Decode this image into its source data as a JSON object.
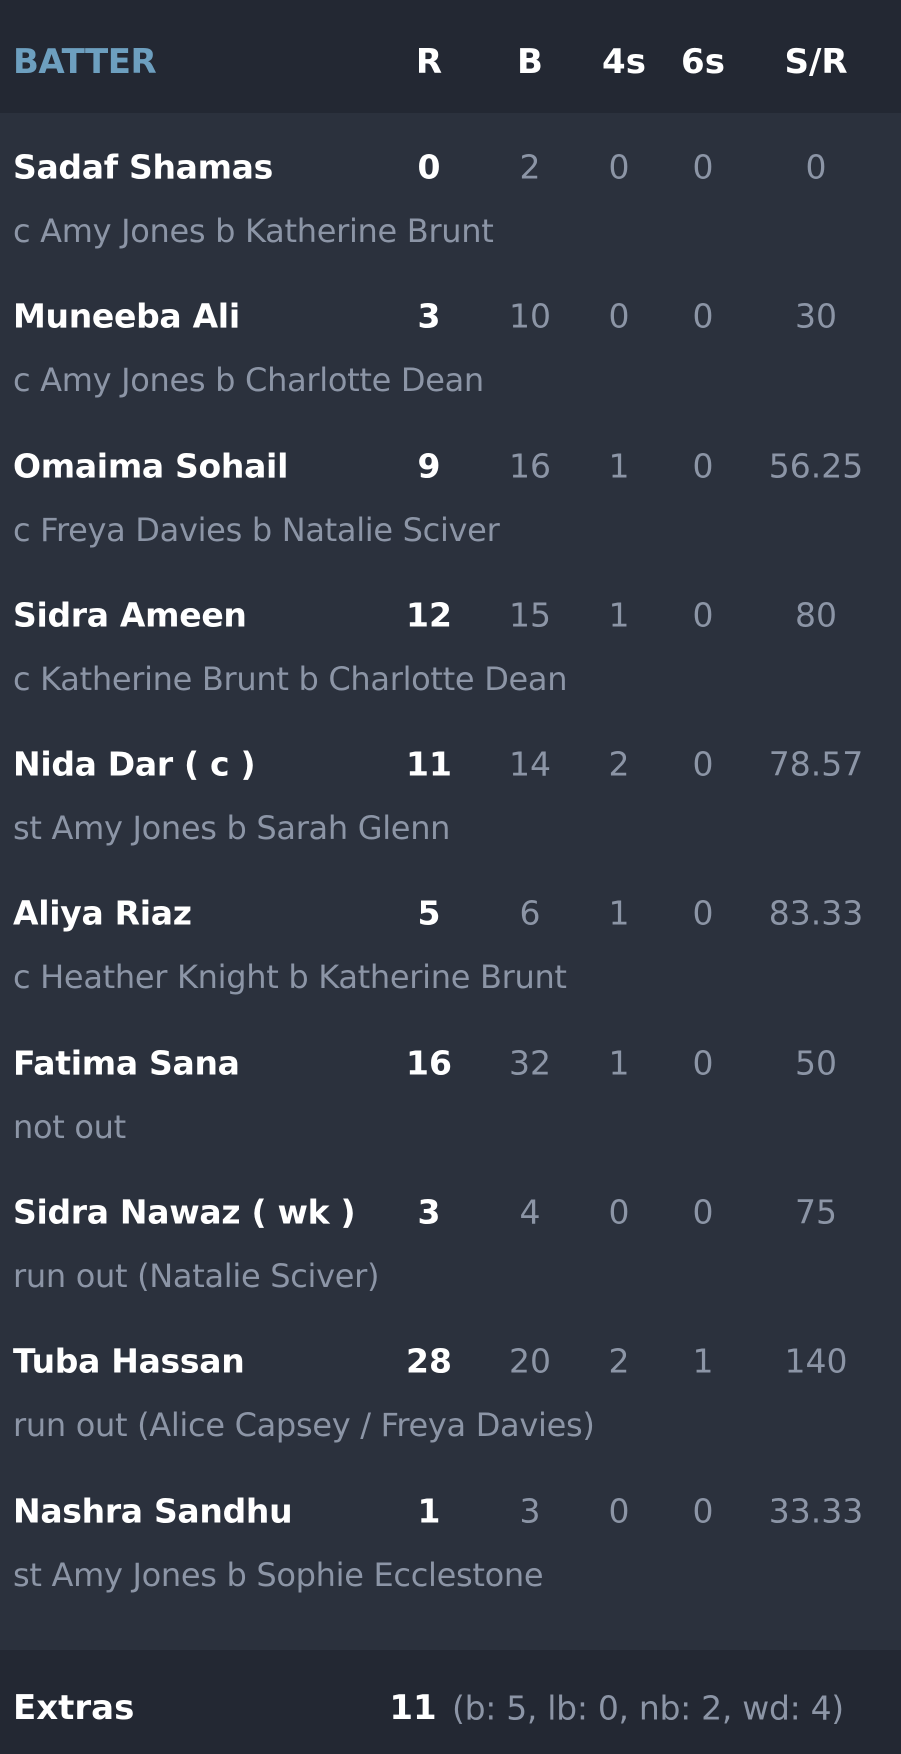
{
  "header": {
    "batter": "BATTER",
    "runs": "R",
    "balls": "B",
    "fours": "4s",
    "sixes": "6s",
    "strike_rate": "S/R"
  },
  "batters": [
    {
      "name": "Sadaf Shamas",
      "dismissal": "c Amy Jones b Katherine Brunt",
      "runs": "0",
      "balls": "2",
      "fours": "0",
      "sixes": "0",
      "sr": "0"
    },
    {
      "name": "Muneeba Ali",
      "dismissal": "c Amy Jones b Charlotte Dean",
      "runs": "3",
      "balls": "10",
      "fours": "0",
      "sixes": "0",
      "sr": "30"
    },
    {
      "name": "Omaima Sohail",
      "dismissal": "c Freya Davies b Natalie Sciver",
      "runs": "9",
      "balls": "16",
      "fours": "1",
      "sixes": "0",
      "sr": "56.25"
    },
    {
      "name": "Sidra Ameen",
      "dismissal": "c Katherine Brunt b Charlotte Dean",
      "runs": "12",
      "balls": "15",
      "fours": "1",
      "sixes": "0",
      "sr": "80"
    },
    {
      "name": "Nida Dar ( c )",
      "dismissal": "st Amy Jones b Sarah Glenn",
      "runs": "11",
      "balls": "14",
      "fours": "2",
      "sixes": "0",
      "sr": "78.57"
    },
    {
      "name": "Aliya Riaz",
      "dismissal": "c Heather Knight b Katherine Brunt",
      "runs": "5",
      "balls": "6",
      "fours": "1",
      "sixes": "0",
      "sr": "83.33"
    },
    {
      "name": "Fatima Sana",
      "dismissal": "not out",
      "runs": "16",
      "balls": "32",
      "fours": "1",
      "sixes": "0",
      "sr": "50"
    },
    {
      "name": "Sidra Nawaz ( wk )",
      "dismissal": "run out (Natalie Sciver)",
      "runs": "3",
      "balls": "4",
      "fours": "0",
      "sixes": "0",
      "sr": "75"
    },
    {
      "name": "Tuba Hassan",
      "dismissal": "run out (Alice Capsey / Freya Davies)",
      "runs": "28",
      "balls": "20",
      "fours": "2",
      "sixes": "1",
      "sr": "140"
    },
    {
      "name": "Nashra Sandhu",
      "dismissal": "st Amy Jones b Sophie Ecclestone",
      "runs": "1",
      "balls": "3",
      "fours": "0",
      "sixes": "0",
      "sr": "33.33"
    }
  ],
  "extras": {
    "label": "Extras",
    "total": "11",
    "breakdown": "(b: 5, lb: 0, nb: 2, wd: 4)"
  }
}
